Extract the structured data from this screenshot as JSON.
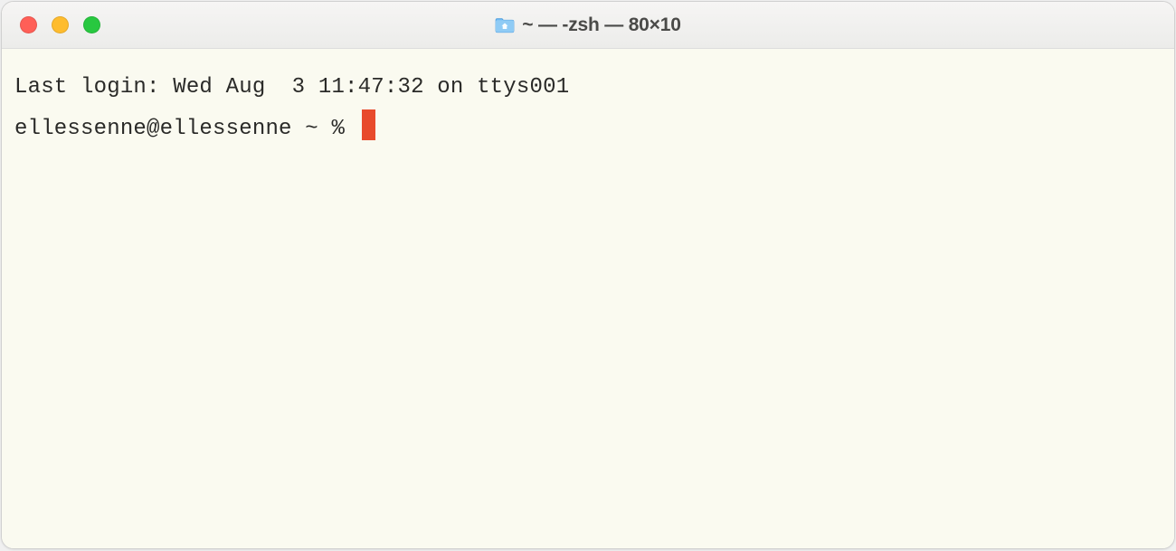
{
  "titlebar": {
    "title": "~ — -zsh — 80×10",
    "icon": "home-folder-icon",
    "lights": {
      "close": {
        "color": "#ff5f57"
      },
      "minimize": {
        "color": "#febc2e"
      },
      "maximize": {
        "color": "#28c840"
      }
    }
  },
  "terminal": {
    "last_login": "Last login: Wed Aug  3 11:47:32 on ttys001",
    "prompt": "ellessenne@ellessenne ~ % ",
    "cursor_color": "#e84a2c",
    "bg_color": "#fafaf0",
    "fg_color": "#2a2a28"
  }
}
